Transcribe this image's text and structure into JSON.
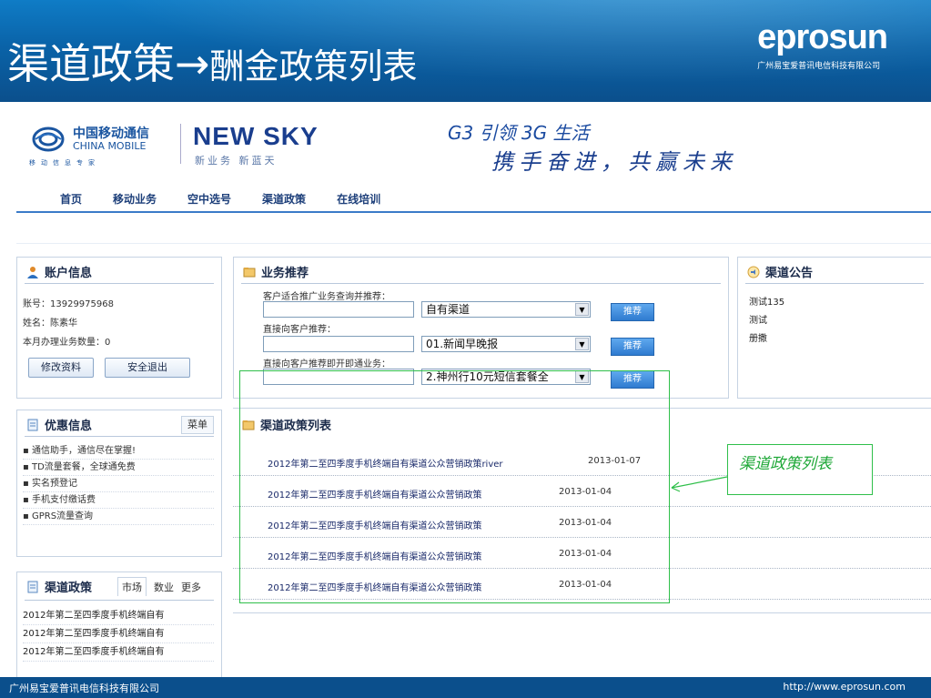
{
  "slide": {
    "title_main": "渠道政策→",
    "title_sub": "酬金政策列表",
    "brand_logo": "eprosun",
    "brand_company": "广州易宝爱普讯电信科技有限公司",
    "footer_company": "广州易宝爱普讯电信科技有限公司",
    "footer_url": "http://www.eprosun.com"
  },
  "site": {
    "cm_name_cn": "中国移动通信",
    "cm_name_en": "CHINA MOBILE",
    "cm_tagline": "移动信息专家",
    "ns_logo": "NEW SKY",
    "ns_sub": "新业务  新蓝天",
    "slogan_line1": "G3 引领 3G 生活",
    "slogan_line2": "携手奋进，共赢未来"
  },
  "nav": {
    "items": [
      "首页",
      "移动业务",
      "空中选号",
      "渠道政策",
      "在线培训"
    ]
  },
  "account": {
    "title": "账户信息",
    "account_line": "账号：13929975968",
    "name_line": "姓名：陈素华",
    "count_line": "本月办理业务数量：0",
    "edit_label": "修改资料",
    "logout_label": "安全退出"
  },
  "recommend": {
    "title": "业务推荐",
    "row1_label": "客户适合推广业务查询并推荐：",
    "row1_select": "自有渠道",
    "row2_label": "直接向客户推荐：",
    "row2_select": "01.新闻早晚报",
    "row3_label": "直接向客户推荐即开即通业务：",
    "row3_select": "2.神州行10元短信套餐全",
    "button_label": "推荐"
  },
  "notice": {
    "title": "渠道公告",
    "items": [
      "测试135",
      "测试",
      "册撒"
    ]
  },
  "promo": {
    "title": "优惠信息",
    "menu_label": "菜单",
    "items": [
      "通信助手，通信尽在掌握!",
      "TD流量套餐，全球通免费",
      "实名预登记",
      "手机支付缴话费",
      "GPRS流量查询"
    ]
  },
  "channel_policy": {
    "title": "渠道政策",
    "tabs": [
      "市场",
      "数业",
      "更多"
    ],
    "items": [
      "2012年第二至四季度手机终端自有",
      "2012年第二至四季度手机终端自有",
      "2012年第二至四季度手机终端自有"
    ]
  },
  "policy_list": {
    "title": "渠道政策列表",
    "rows": [
      {
        "title": "2012年第二至四季度手机终端自有渠道公众营销政策river",
        "date": "2013-01-07"
      },
      {
        "title": "2012年第二至四季度手机终端自有渠道公众营销政策",
        "date": "2013-01-04"
      },
      {
        "title": "2012年第二至四季度手机终端自有渠道公众营销政策",
        "date": "2013-01-04"
      },
      {
        "title": "2012年第二至四季度手机终端自有渠道公众营销政策",
        "date": "2013-01-04"
      },
      {
        "title": "2012年第二至四季度手机终端自有渠道公众营销政策",
        "date": "2013-01-04"
      }
    ]
  },
  "annotation": {
    "callout": "渠道政策列表"
  },
  "colors": {
    "header_blue": "#0b63a8",
    "nav_text": "#1d3f7a",
    "annotation_green": "#1fa838",
    "button_blue": "#2f7bd0"
  }
}
